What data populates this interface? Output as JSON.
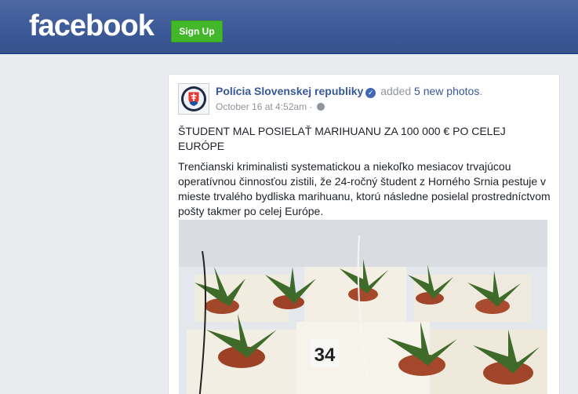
{
  "header": {
    "logo_text": "facebook",
    "signup_label": "Sign Up"
  },
  "post": {
    "page_name": "Polícia Slovenskej republiky",
    "action_prefix": "added",
    "action_link": "5 new photos",
    "action_suffix": ".",
    "timestamp": "October 16 at 4:52am",
    "meta_separator": "·",
    "title": "ŠTUDENT MAL POSIELAŤ MARIHUANU ZA 100 000 € PO CELEJ EURÓPE",
    "body": "Trenčianski kriminalisti systematickou a niekoľko mesiacov trvajúcou operatívnou činnosťou zistili, že 24-ročný študent z Horného Srnia pestuje v mieste trvalého bydliska marihuanu, ktorú následne posielal prostredníctvom pošty takmer po celej Európe.",
    "photo_label": "34"
  },
  "colors": {
    "brand_blue": "#3b5998",
    "signup_green": "#42b72a",
    "link_blue": "#365899",
    "meta_gray": "#90949c"
  },
  "icons": [
    "verified-badge-icon",
    "globe-icon",
    "police-emblem-avatar"
  ]
}
